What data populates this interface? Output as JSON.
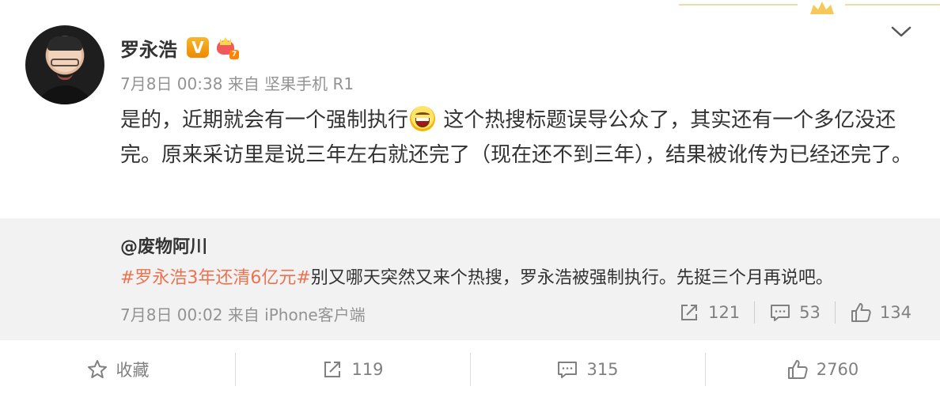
{
  "post": {
    "author": "罗永浩",
    "verified_badge": "V",
    "member_level": "7",
    "timestamp": "7月8日 00:38",
    "source": "来自 坚果手机 R1",
    "text_before_emoji": "是的，近期就会有一个强制执行",
    "emoji": "laughing-face-emoji",
    "text_after_emoji": " 这个热搜标题误导公众了，其实还有一个多亿没还完。原来采访里是说三年左右就还完了（现在还不到三年），结果被讹传为已经还完了。"
  },
  "repost": {
    "author": "@废物阿川",
    "hashtag": "#罗永浩3年还清6亿元#",
    "text": "别又哪天突然又来个热搜，罗永浩被强制执行。先挺三个月再说吧。",
    "timestamp": "7月8日 00:02",
    "source": "来自 iPhone客户端",
    "actions": [
      {
        "icon": "share-icon",
        "count": "121"
      },
      {
        "icon": "comment-icon",
        "count": "53"
      },
      {
        "icon": "like-icon",
        "count": "134"
      }
    ]
  },
  "bottom_bar": [
    {
      "icon": "star-icon",
      "label": "收藏"
    },
    {
      "icon": "share-icon",
      "label": "119"
    },
    {
      "icon": "comment-icon",
      "label": "315"
    },
    {
      "icon": "like-icon",
      "label": "2760"
    }
  ],
  "colors": {
    "accent": "#eb7350",
    "text": "#333333",
    "meta": "#939393",
    "repost_bg": "#f2f2f2",
    "badge": "#f8b62d"
  }
}
